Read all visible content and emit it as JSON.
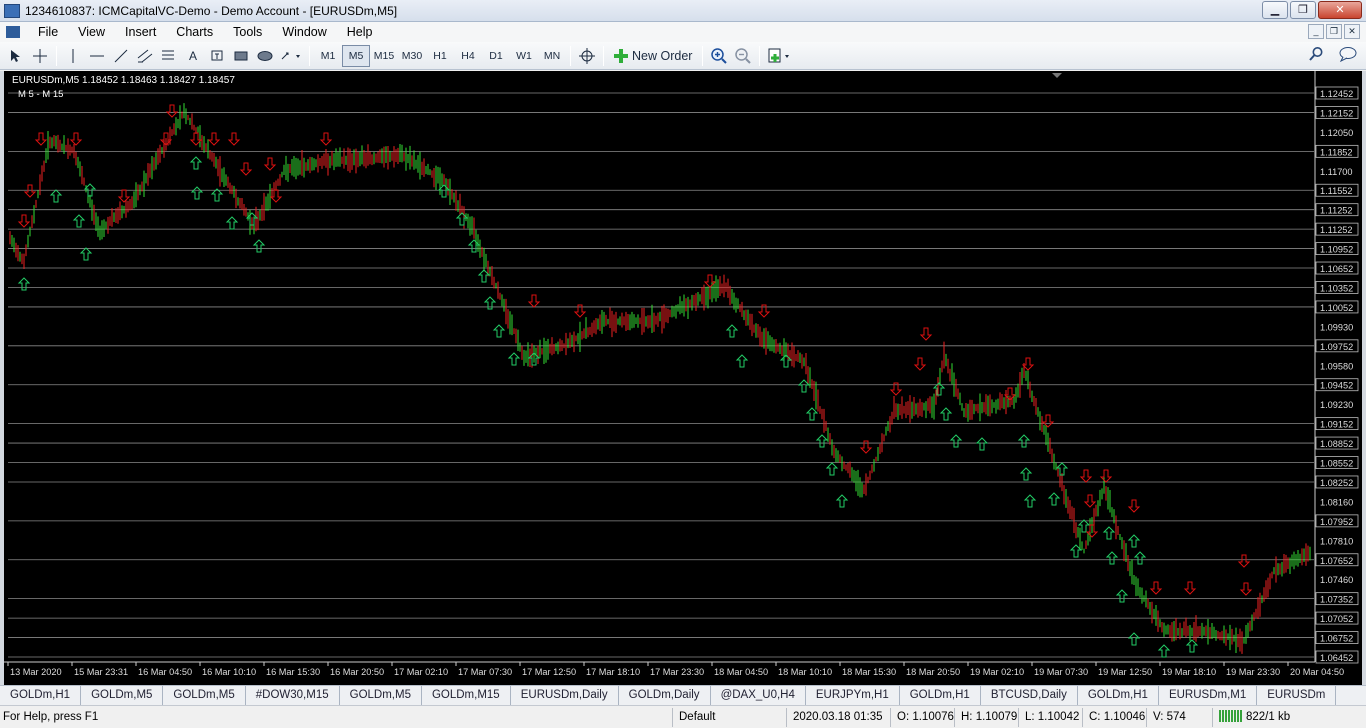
{
  "window": {
    "title": "1234610837: ICMCapitalVC-Demo - Demo Account - [EURUSDm,M5]",
    "min_label": "▁",
    "max_label": "❐",
    "close_label": "✕"
  },
  "menu": {
    "items": [
      "File",
      "View",
      "Insert",
      "Charts",
      "Tools",
      "Window",
      "Help"
    ],
    "mdi": [
      "_",
      "❐",
      "✕"
    ]
  },
  "toolbar": {
    "timeframes": [
      "M1",
      "M5",
      "M15",
      "M30",
      "H1",
      "H4",
      "D1",
      "W1",
      "MN"
    ],
    "active_timeframe": "M5",
    "new_order_label": "New Order",
    "text_tool_label": "A"
  },
  "chart": {
    "symbol_line": "EURUSDm,M5  1.18452 1.18463 1.18427 1.18457",
    "indicator_line": "M 5 - M 15",
    "price_labels": [
      "1.12452",
      "1.12152",
      "1.12050",
      "1.11852",
      "1.11700",
      "1.11552",
      "1.11252",
      "1.11252",
      "1.10952",
      "1.10652",
      "1.10352",
      "1.10052",
      "1.09930",
      "1.09752",
      "1.09580",
      "1.09452",
      "1.09230",
      "1.09152",
      "1.08852",
      "1.08552",
      "1.08252",
      "1.08160",
      "1.07952",
      "1.07810",
      "1.07652",
      "1.07460",
      "1.07352",
      "1.07052",
      "1.06752",
      "1.06452"
    ],
    "time_labels": [
      "13 Mar 2020",
      "15 Mar 23:31",
      "16 Mar 04:50",
      "16 Mar 10:10",
      "16 Mar 15:30",
      "16 Mar 20:50",
      "17 Mar 02:10",
      "17 Mar 07:30",
      "17 Mar 12:50",
      "17 Mar 18:10",
      "17 Mar 23:30",
      "18 Mar 04:50",
      "18 Mar 10:10",
      "18 Mar 15:30",
      "18 Mar 20:50",
      "19 Mar 02:10",
      "19 Mar 07:30",
      "19 Mar 12:50",
      "19 Mar 18:10",
      "19 Mar 23:30",
      "20 Mar 04:50"
    ],
    "colors": {
      "up": "#33dd33",
      "down": "#ee2222",
      "grid": "#8a8a8a",
      "up_arrow": "#22cc66",
      "down_arrow": "#dd1111"
    }
  },
  "tabs": [
    "GOLDm,H1",
    "GOLDm,M5",
    "GOLDm,M5",
    "#DOW30,M15",
    "GOLDm,M5",
    "GOLDm,M15",
    "EURUSDm,Daily",
    "GOLDm,Daily",
    "@DAX_U0,H4",
    "EURJPYm,H1",
    "GOLDm,H1",
    "BTCUSD,Daily",
    "GOLDm,H1",
    "EURUSDm,M1",
    "EURUSDm"
  ],
  "status": {
    "help": "For Help, press F1",
    "profile": "Default",
    "datetime": "2020.03.18 01:35",
    "open": "O: 1.10076",
    "high": "H: 1.10079",
    "low": "L: 1.10042",
    "close": "C: 1.10046",
    "volume": "V: 574",
    "traffic": "822/1 kb"
  }
}
